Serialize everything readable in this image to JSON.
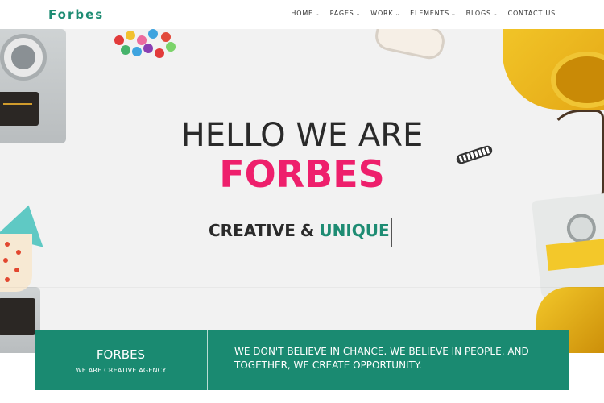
{
  "header": {
    "logo": "Forbes",
    "nav": [
      {
        "label": "HOME",
        "has_dropdown": true
      },
      {
        "label": "PAGES",
        "has_dropdown": true
      },
      {
        "label": "WORK",
        "has_dropdown": true
      },
      {
        "label": "ELEMENTS",
        "has_dropdown": true
      },
      {
        "label": "BLOGS",
        "has_dropdown": true
      },
      {
        "label": "CONTACT US",
        "has_dropdown": false
      }
    ],
    "dropdown_icon": "chevron-down-icon"
  },
  "hero": {
    "heading": "HELLO WE ARE",
    "brand": "FORBES",
    "tagline_prefix": "CREATIVE",
    "tagline_amp": "&",
    "tagline_accent": "UNIQUE"
  },
  "info": {
    "title": "FORBES",
    "subtitle": "WE ARE CREATIVE AGENCY",
    "quote": "WE DON'T BELIEVE IN CHANCE. WE BELIEVE IN PEOPLE. AND\nTOGETHER, WE CREATE OPPORTUNITY."
  },
  "colors": {
    "brand_green": "#1a8a71",
    "brand_pink": "#ee1f6c",
    "dark_text": "#2a2a2a"
  }
}
